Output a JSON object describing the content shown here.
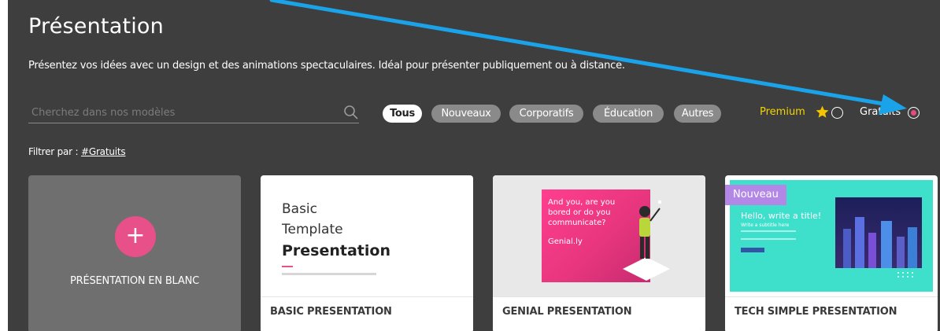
{
  "page": {
    "title": "Présentation",
    "subtitle": "Présentez vos idées avec un design et des animations spectaculaires. Idéal pour présenter publiquement ou à distance."
  },
  "search": {
    "placeholder": "Cherchez dans nos modèles",
    "value": "",
    "icon": "search-icon"
  },
  "filters": [
    {
      "label": "Tous",
      "active": true
    },
    {
      "label": "Nouveaux",
      "active": false
    },
    {
      "label": "Corporatifs",
      "active": false
    },
    {
      "label": "Éducation",
      "active": false
    },
    {
      "label": "Autres",
      "active": false
    }
  ],
  "pricing": {
    "premium_label": "Premium",
    "premium_icon": "star-icon",
    "premium_selected": false,
    "free_label": "Gratuits",
    "free_selected": true
  },
  "filter_by": {
    "prefix": "Filtrer par : ",
    "tag": "#Gratuits"
  },
  "cards": [
    {
      "kind": "blank",
      "label": "PRÉSENTATION EN BLANC",
      "icon": "plus-icon"
    },
    {
      "kind": "template",
      "name": "BASIC PRESENTATION",
      "thumb": {
        "line1": "Basic",
        "line2": "Template",
        "line3": "Presentation"
      }
    },
    {
      "kind": "template",
      "name": "GENIAL PRESENTATION",
      "thumb": {
        "text": "And you, are you bored or do you communicate?",
        "brand": "Genial.ly"
      }
    },
    {
      "kind": "template",
      "name": "TECH SIMPLE PRESENTATION",
      "badge": "Nouveau",
      "thumb": {
        "title": "Hello, write a title!",
        "subtitle": "Write a subtitle here"
      }
    }
  ],
  "colors": {
    "background": "#3e3e3e",
    "accent_pink": "#e8508a",
    "premium_yellow": "#f5d300",
    "badge_purple": "#b287e6",
    "tech_teal": "#3ee0cc",
    "annotation_arrow": "#1aa3e8"
  }
}
